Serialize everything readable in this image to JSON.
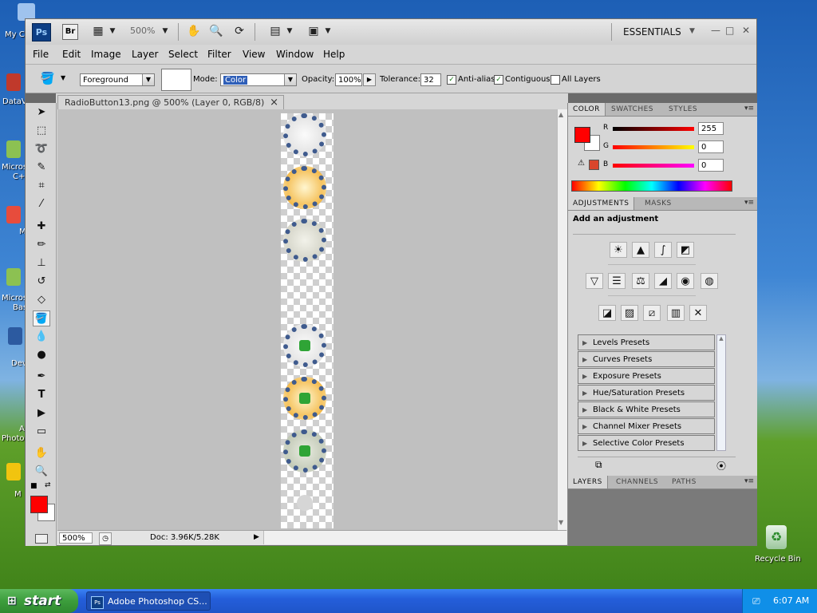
{
  "desktop": {
    "icons": [
      {
        "label": "My C"
      },
      {
        "label": "DataV"
      },
      {
        "label": "Micros"
      },
      {
        "label": "C+"
      },
      {
        "label": "M"
      },
      {
        "label": "Micros"
      },
      {
        "label": "Bas"
      },
      {
        "label": "Dev"
      },
      {
        "label": "A"
      },
      {
        "label": "Photo"
      },
      {
        "label": "M"
      }
    ],
    "recycle_bin": "Recycle Bin"
  },
  "appbar": {
    "ps_logo": "Ps",
    "br_logo": "Br",
    "zoom": "500%",
    "workspace": "ESSENTIALS"
  },
  "menu": [
    "File",
    "Edit",
    "Image",
    "Layer",
    "Select",
    "Filter",
    "View",
    "Window",
    "Help"
  ],
  "options": {
    "fill_source": "Foreground",
    "mode_label": "Mode:",
    "mode_value": "Color",
    "opacity_label": "Opacity:",
    "opacity_value": "100%",
    "tolerance_label": "Tolerance:",
    "tolerance_value": "32",
    "anti_alias": "Anti-alias",
    "contiguous": "Contiguous",
    "all_layers": "All Layers"
  },
  "document": {
    "tab_title": "RadioButton13.png @ 500% (Layer 0, RGB/8)",
    "close": "×",
    "zoom": "500%",
    "doc_size": "Doc: 3.96K/5.28K"
  },
  "color_panel": {
    "tabs": [
      "COLOR",
      "SWATCHES",
      "STYLES"
    ],
    "r_label": "R",
    "g_label": "G",
    "b_label": "B",
    "r_value": "255",
    "g_value": "0",
    "b_value": "0",
    "foreground": "#ff0000",
    "background": "#ffffff"
  },
  "adjustments_panel": {
    "tabs": [
      "ADJUSTMENTS",
      "MASKS"
    ],
    "heading": "Add an adjustment",
    "presets": [
      "Levels Presets",
      "Curves Presets",
      "Exposure Presets",
      "Hue/Saturation Presets",
      "Black & White Presets",
      "Channel Mixer Presets",
      "Selective Color Presets"
    ]
  },
  "layers_panel": {
    "tabs": [
      "LAYERS",
      "CHANNELS",
      "PATHS"
    ]
  },
  "taskbar": {
    "start": "start",
    "task": "Adobe Photoshop CS...",
    "clock": "6:07 AM"
  }
}
